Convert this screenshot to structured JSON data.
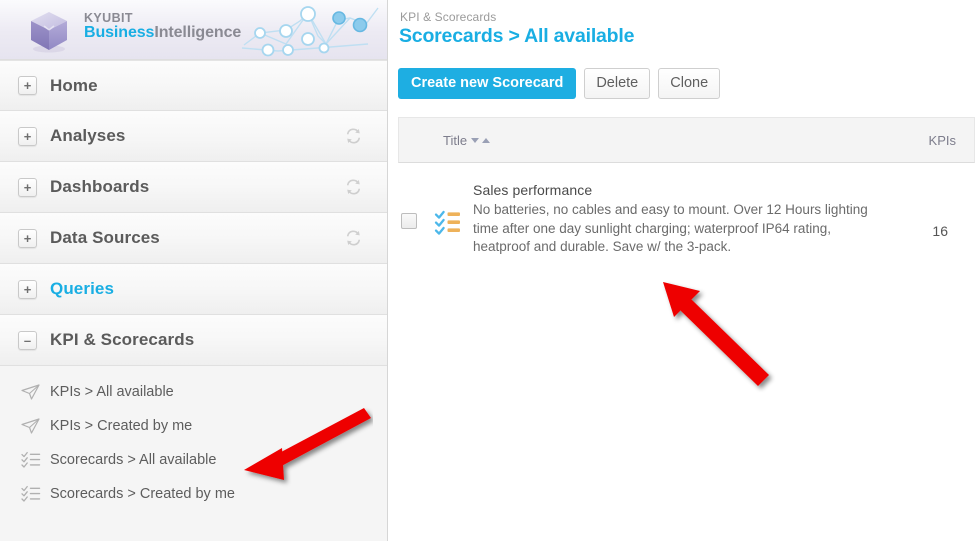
{
  "brand": {
    "line1": "KYUBIT",
    "line2_highlight": "Business",
    "line2_rest": "Intelligence",
    "accent_color": "#19aee3",
    "logo_icon": "cube-icon",
    "graphic_icon": "network-chart-icon"
  },
  "sidebar": {
    "items": [
      {
        "label": "Home",
        "expander": "+",
        "expanded": false,
        "refresh": false,
        "highlight": false,
        "icon": "plus-expander-icon"
      },
      {
        "label": "Analyses",
        "expander": "+",
        "expanded": false,
        "refresh": true,
        "highlight": false,
        "icon": "plus-expander-icon"
      },
      {
        "label": "Dashboards",
        "expander": "+",
        "expanded": false,
        "refresh": true,
        "highlight": false,
        "icon": "plus-expander-icon"
      },
      {
        "label": "Data Sources",
        "expander": "+",
        "expanded": false,
        "refresh": true,
        "highlight": false,
        "icon": "plus-expander-icon"
      },
      {
        "label": "Queries",
        "expander": "+",
        "expanded": false,
        "refresh": false,
        "highlight": true,
        "icon": "plus-expander-icon"
      },
      {
        "label": "KPI & Scorecards",
        "expander": "–",
        "expanded": true,
        "refresh": false,
        "highlight": false,
        "icon": "minus-expander-icon"
      }
    ],
    "subitems": [
      {
        "label": "KPIs > All available",
        "icon": "paper-plane-icon"
      },
      {
        "label": "KPIs > Created by me",
        "icon": "paper-plane-icon"
      },
      {
        "label": "Scorecards > All available",
        "icon": "checklist-icon"
      },
      {
        "label": "Scorecards > Created by me",
        "icon": "checklist-icon"
      }
    ],
    "refresh_icon": "refresh-sync-icon"
  },
  "main": {
    "breadcrumb": "KPI & Scorecards",
    "page_title": "Scorecards > All available",
    "toolbar": {
      "create_label": "Create new Scorecard",
      "delete_label": "Delete",
      "clone_label": "Clone"
    },
    "table": {
      "columns": {
        "title": "Title",
        "kpis": "KPIs"
      },
      "sort_desc_icon": "caret-down-icon",
      "sort_asc_icon": "caret-up-icon",
      "rows": [
        {
          "checked": false,
          "icon": "scorecard-checklist-icon",
          "title": "Sales performance",
          "description": "No batteries, no cables and easy to mount. Over 12 Hours lighting time after one day sunlight charging; waterproof IP64 rating, heatproof and durable. Save w/ the 3-pack.",
          "kpis": "16"
        }
      ]
    }
  },
  "annotations": {
    "arrow_color": "#ee0000",
    "arrows": [
      {
        "name": "arrow-pointing-to-scorecard-row",
        "direction": "up-left"
      },
      {
        "name": "arrow-pointing-to-scorecards-all-available",
        "direction": "down-left"
      }
    ]
  }
}
